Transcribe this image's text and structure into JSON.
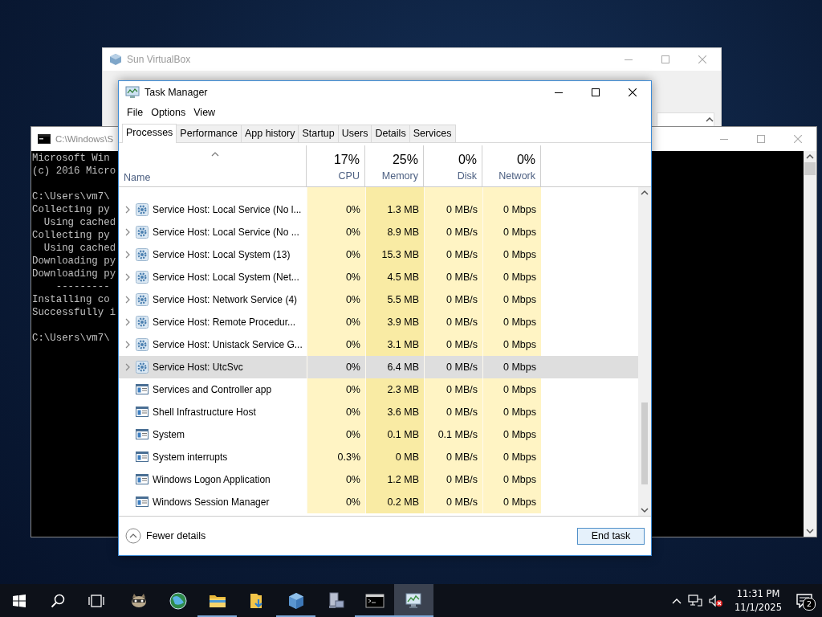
{
  "virtualbox_window": {
    "title": "Sun VirtualBox"
  },
  "console_window": {
    "title": "C:\\Windows\\S",
    "blocks": [
      [
        "Microsoft Win",
        "(c) 2016 Micro"
      ],
      [
        "C:\\Users\\vm7\\",
        "Collecting py",
        "  Using cached",
        "Collecting py",
        "  Using cached",
        "Downloading py",
        "Downloading py",
        "    ---------",
        "Installing co",
        "Successfully i"
      ],
      [
        "C:\\Users\\vm7\\"
      ]
    ]
  },
  "task_manager": {
    "title": "Task Manager",
    "menu": [
      "File",
      "Options",
      "View"
    ],
    "tabs": [
      {
        "label": "Processes",
        "selected": true
      },
      {
        "label": "Performance",
        "selected": false
      },
      {
        "label": "App history",
        "selected": false
      },
      {
        "label": "Startup",
        "selected": false
      },
      {
        "label": "Users",
        "selected": false
      },
      {
        "label": "Details",
        "selected": false
      },
      {
        "label": "Services",
        "selected": false
      }
    ],
    "name_column": {
      "label": "Name"
    },
    "columns": [
      {
        "percent": "17%",
        "label": "CPU",
        "color": "#fff4c4"
      },
      {
        "percent": "25%",
        "label": "Memory",
        "color": "#f9eba4"
      },
      {
        "percent": "0%",
        "label": "Disk",
        "color": "#fff4c4"
      },
      {
        "percent": "0%",
        "label": "Network",
        "color": "#fff4c4"
      }
    ],
    "rows": [
      {
        "kind": "service",
        "name": "Service Host: Local Service (No l...",
        "cells": [
          "0%",
          "1.3 MB",
          "0 MB/s",
          "0 Mbps"
        ],
        "selected": false
      },
      {
        "kind": "service",
        "name": "Service Host: Local Service (No ...",
        "cells": [
          "0%",
          "8.9 MB",
          "0 MB/s",
          "0 Mbps"
        ],
        "selected": false
      },
      {
        "kind": "service",
        "name": "Service Host: Local System (13)",
        "cells": [
          "0%",
          "15.3 MB",
          "0 MB/s",
          "0 Mbps"
        ],
        "selected": false
      },
      {
        "kind": "service",
        "name": "Service Host: Local System (Net...",
        "cells": [
          "0%",
          "4.5 MB",
          "0 MB/s",
          "0 Mbps"
        ],
        "selected": false
      },
      {
        "kind": "service",
        "name": "Service Host: Network Service (4)",
        "cells": [
          "0%",
          "5.5 MB",
          "0 MB/s",
          "0 Mbps"
        ],
        "selected": false
      },
      {
        "kind": "service",
        "name": "Service Host: Remote Procedur...",
        "cells": [
          "0%",
          "3.9 MB",
          "0 MB/s",
          "0 Mbps"
        ],
        "selected": false
      },
      {
        "kind": "service",
        "name": "Service Host: Unistack Service G...",
        "cells": [
          "0%",
          "3.1 MB",
          "0 MB/s",
          "0 Mbps"
        ],
        "selected": false
      },
      {
        "kind": "service",
        "name": "Service Host: UtcSvc",
        "cells": [
          "0%",
          "6.4 MB",
          "0 MB/s",
          "0 Mbps"
        ],
        "selected": true
      },
      {
        "kind": "app",
        "name": "Services and Controller app",
        "cells": [
          "0%",
          "2.3 MB",
          "0 MB/s",
          "0 Mbps"
        ],
        "selected": false
      },
      {
        "kind": "app",
        "name": "Shell Infrastructure Host",
        "cells": [
          "0%",
          "3.6 MB",
          "0 MB/s",
          "0 Mbps"
        ],
        "selected": false
      },
      {
        "kind": "app",
        "name": "System",
        "cells": [
          "0%",
          "0.1 MB",
          "0.1 MB/s",
          "0 Mbps"
        ],
        "selected": false
      },
      {
        "kind": "app",
        "name": "System interrupts",
        "cells": [
          "0.3%",
          "0 MB",
          "0 MB/s",
          "0 Mbps"
        ],
        "selected": false
      },
      {
        "kind": "app",
        "name": "Windows Logon Application",
        "cells": [
          "0%",
          "1.2 MB",
          "0 MB/s",
          "0 Mbps"
        ],
        "selected": false
      },
      {
        "kind": "app",
        "name": "Windows Session Manager",
        "cells": [
          "0%",
          "0.2 MB",
          "0 MB/s",
          "0 Mbps"
        ],
        "selected": false
      }
    ],
    "footer": {
      "toggle": "Fewer details",
      "button": "End task"
    }
  },
  "taskbar": {
    "apps": [
      {
        "kind": "raccoon",
        "running": false,
        "active": false
      },
      {
        "kind": "globe",
        "running": false,
        "active": false
      },
      {
        "kind": "folder",
        "running": true,
        "active": false
      },
      {
        "kind": "download",
        "running": false,
        "active": false
      },
      {
        "kind": "cube",
        "running": true,
        "active": false
      },
      {
        "kind": "computer",
        "running": false,
        "active": false
      },
      {
        "kind": "console",
        "running": true,
        "active": false
      },
      {
        "kind": "monitor",
        "running": true,
        "active": true
      }
    ],
    "clock": {
      "time": "11:31 PM",
      "date": "11/1/2025"
    },
    "notifications": "2"
  }
}
